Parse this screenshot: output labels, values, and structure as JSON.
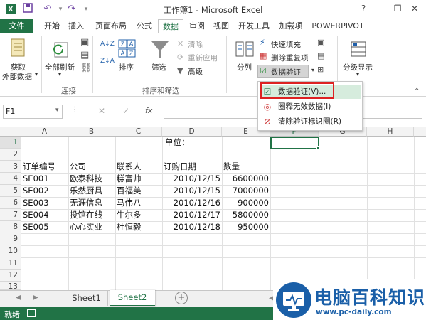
{
  "window": {
    "title": "工作簿1 - Microsoft Excel"
  },
  "quick_access": {
    "save_icon": "save-icon",
    "undo_icon": "undo-icon",
    "redo_icon": "redo-icon"
  },
  "window_controls": {
    "help": "?",
    "minimize": "–",
    "restore": "❐",
    "close": "✕"
  },
  "tabs": [
    "文件",
    "开始",
    "插入",
    "页面布局",
    "公式",
    "数据",
    "审阅",
    "视图",
    "开发工具",
    "加载项",
    "POWERPIVOT"
  ],
  "active_tab": "数据",
  "ribbon": {
    "get_external": [
      "获取",
      "外部数据"
    ],
    "refresh_all": "全部刷新",
    "sort": "排序",
    "filter": "筛选",
    "clear": "清除",
    "reapply": "重新应用",
    "advanced": "高级",
    "split": "分列",
    "flash_fill": "快速填充",
    "remove_dup": "删除重复项",
    "data_validation": "数据验证",
    "outline": "分级显示",
    "groups": {
      "connections": "连接",
      "sort_filter": "排序和筛选"
    }
  },
  "menu": {
    "items": [
      "数据验证(V)...",
      "圈释无效数据(I)",
      "清除验证标识圈(R)"
    ]
  },
  "formula_bar": {
    "name_box": "F1",
    "fx": "fx"
  },
  "sheet": {
    "columns": [
      "A",
      "B",
      "C",
      "D",
      "E",
      "F",
      "G",
      "H"
    ],
    "rows": [
      "1",
      "2",
      "3",
      "4",
      "5",
      "6",
      "7",
      "8",
      "9",
      "10",
      "11",
      "12",
      "13"
    ],
    "d1_label": "单位：",
    "headers": [
      "订单编号",
      "公司",
      "联系人",
      "订购日期",
      "数量"
    ],
    "data": [
      [
        "SE001",
        "欧泰科技",
        "糕富帅",
        "2010/12/15",
        "6600000"
      ],
      [
        "SE002",
        "乐然厨具",
        "百福美",
        "2010/12/15",
        "7000000"
      ],
      [
        "SE003",
        "无涯信息",
        "马伟八",
        "2010/12/16",
        "900000"
      ],
      [
        "SE004",
        "投馆在线",
        "牛尔多",
        "2010/12/17",
        "5800000"
      ],
      [
        "SE005",
        "心心实业",
        "杜恒毅",
        "2010/12/18",
        "950000"
      ]
    ]
  },
  "sheet_tabs": [
    "Sheet1",
    "Sheet2"
  ],
  "status": {
    "ready": "就绪"
  },
  "watermark": {
    "brand": "电脑百科知识",
    "url": "www.pc-daily.com"
  },
  "colors": {
    "accent": "#217346",
    "highlight": "#dd2222",
    "watermark_blue": "#1a5fa8"
  }
}
